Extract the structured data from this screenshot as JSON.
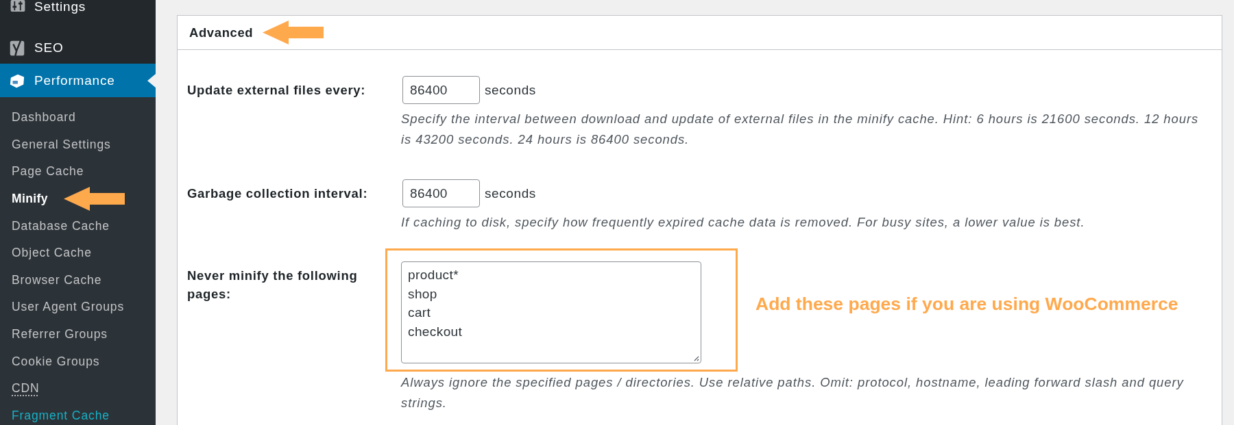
{
  "sidebar": {
    "menu": [
      {
        "label": "Settings",
        "selected": false
      },
      {
        "label": "SEO",
        "selected": false
      },
      {
        "label": "Performance",
        "selected": true
      }
    ],
    "submenu": [
      {
        "label": "Dashboard",
        "selected": false,
        "hovered": false,
        "abbreviation": false,
        "arrow": false
      },
      {
        "label": "General Settings",
        "selected": false,
        "hovered": false,
        "abbreviation": false,
        "arrow": false
      },
      {
        "label": "Page Cache",
        "selected": false,
        "hovered": false,
        "abbreviation": false,
        "arrow": false
      },
      {
        "label": "Minify",
        "selected": true,
        "hovered": false,
        "abbreviation": false,
        "arrow": true
      },
      {
        "label": "Database Cache",
        "selected": false,
        "hovered": false,
        "abbreviation": false,
        "arrow": false
      },
      {
        "label": "Object Cache",
        "selected": false,
        "hovered": false,
        "abbreviation": false,
        "arrow": false
      },
      {
        "label": "Browser Cache",
        "selected": false,
        "hovered": false,
        "abbreviation": false,
        "arrow": false
      },
      {
        "label": "User Agent Groups",
        "selected": false,
        "hovered": false,
        "abbreviation": false,
        "arrow": false
      },
      {
        "label": "Referrer Groups",
        "selected": false,
        "hovered": false,
        "abbreviation": false,
        "arrow": false
      },
      {
        "label": "Cookie Groups",
        "selected": false,
        "hovered": false,
        "abbreviation": false,
        "arrow": false
      },
      {
        "label": "CDN",
        "selected": false,
        "hovered": false,
        "abbreviation": true,
        "arrow": false
      },
      {
        "label": "Fragment Cache",
        "selected": false,
        "hovered": true,
        "abbreviation": false,
        "arrow": false
      }
    ]
  },
  "panel": {
    "title": "Advanced",
    "title_arrow": true,
    "settings": [
      {
        "kind": "number",
        "label": "Update external files every:",
        "value": "86400",
        "unit": "seconds",
        "description": "Specify the interval between download and update of external files in the minify cache. Hint: 6 hours is 21600 seconds. 12 hours is 43200 seconds. 24 hours is 86400 seconds.",
        "highlighted": false
      },
      {
        "kind": "number",
        "label": "Garbage collection interval:",
        "value": "86400",
        "unit": "seconds",
        "description": "If caching to disk, specify how frequently expired cache data is removed. For busy sites, a lower value is best.",
        "highlighted": false
      },
      {
        "kind": "textarea",
        "label": "Never minify the following pages:",
        "value": "product*\nshop\ncart\ncheckout",
        "description": "Always ignore the specified pages / directories. Use relative paths. Omit: protocol, hostname, leading forward slash and query strings.",
        "highlighted": true,
        "note": "Add these pages if you are using WooCommerce"
      }
    ]
  }
}
